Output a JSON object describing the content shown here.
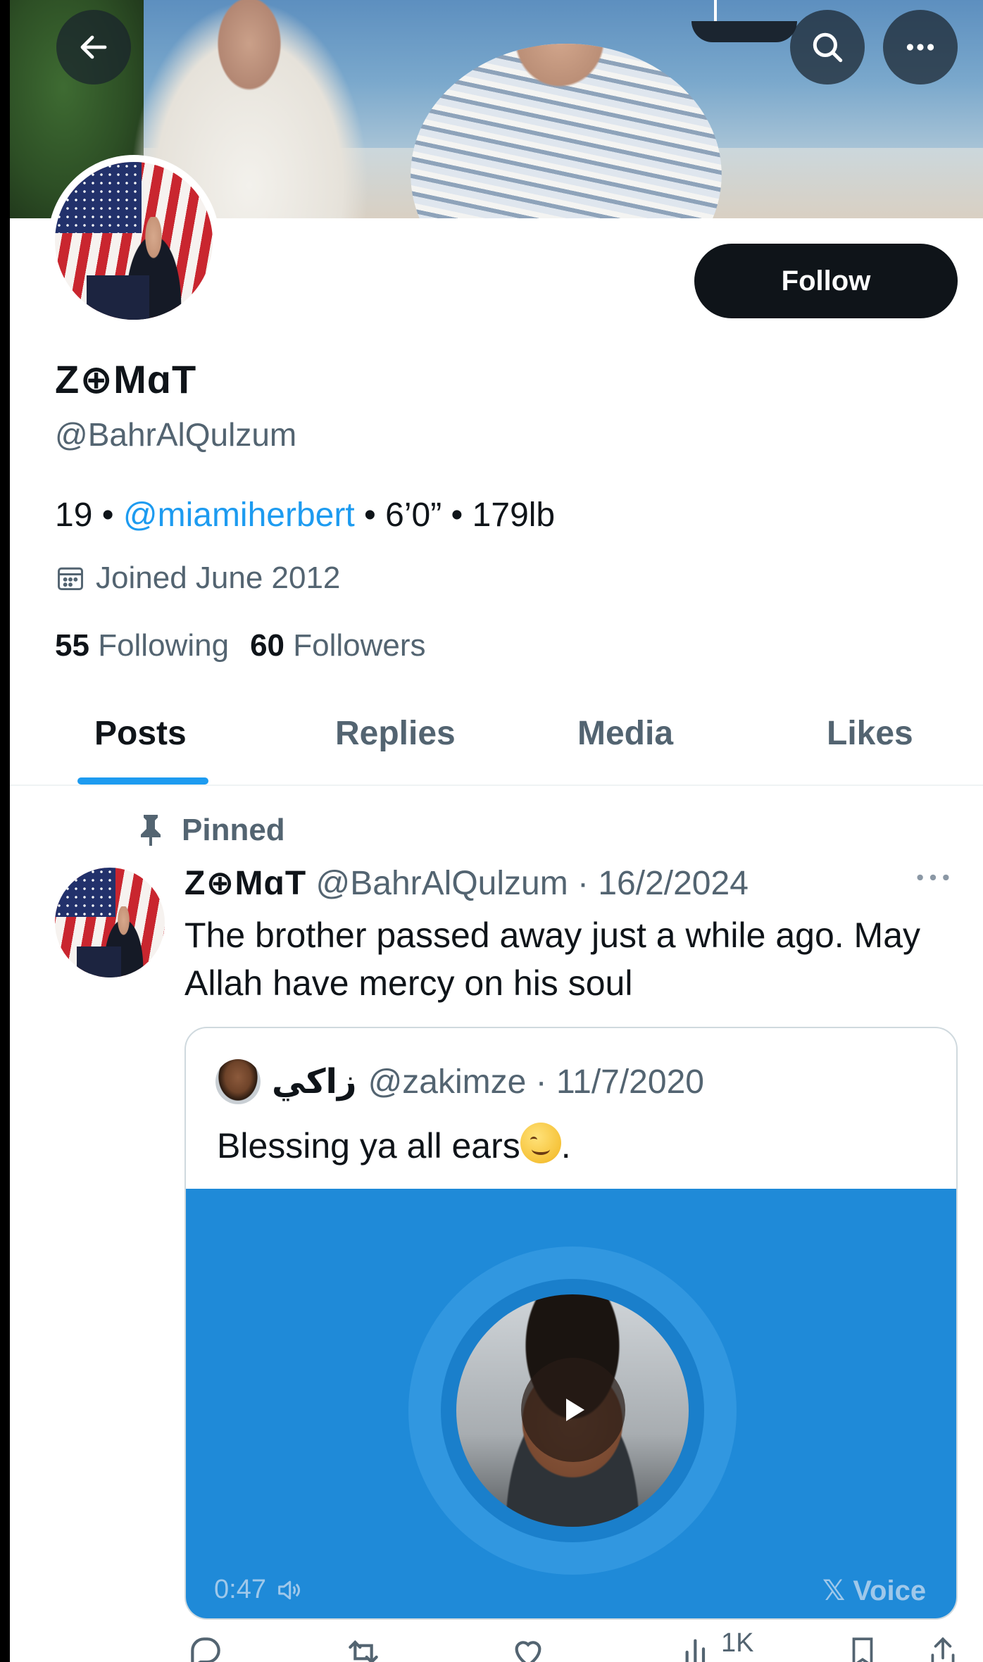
{
  "header": {
    "back_icon": "arrow-left-icon",
    "search_icon": "search-icon",
    "more_icon": "more-horizontal-icon"
  },
  "profile": {
    "follow_label": "Follow",
    "display_name": "Z⊕MɑT",
    "handle": "@BahrAlQulzum",
    "bio_prefix": "19 • ",
    "bio_link": "@miamiherbert",
    "bio_suffix": " • 6’0” • 179lb",
    "joined": "Joined June 2012",
    "following_count": "55",
    "following_label": "Following",
    "followers_count": "60",
    "followers_label": "Followers"
  },
  "tabs": [
    {
      "label": "Posts",
      "active": true
    },
    {
      "label": "Replies",
      "active": false
    },
    {
      "label": "Media",
      "active": false
    },
    {
      "label": "Likes",
      "active": false
    }
  ],
  "tweet": {
    "pinned_label": "Pinned",
    "author_name": "Z⊕MɑT",
    "author_handle": "@BahrAlQulzum",
    "date": "16/2/2024",
    "text": "The brother passed away just a while ago. May Allah have mercy on his soul",
    "quote": {
      "name": "زاكي",
      "handle": "@zakimze",
      "date": "11/7/2020",
      "text": "Blessing ya all ears",
      "text_end": ".",
      "duration": "0:47",
      "badge": "𝕏 Voice"
    },
    "views_partial": "1K"
  },
  "colors": {
    "accent": "#1d9bf0",
    "voice_bg": "#1f8ad8",
    "text_primary": "#0f1419",
    "text_secondary": "#536471"
  }
}
